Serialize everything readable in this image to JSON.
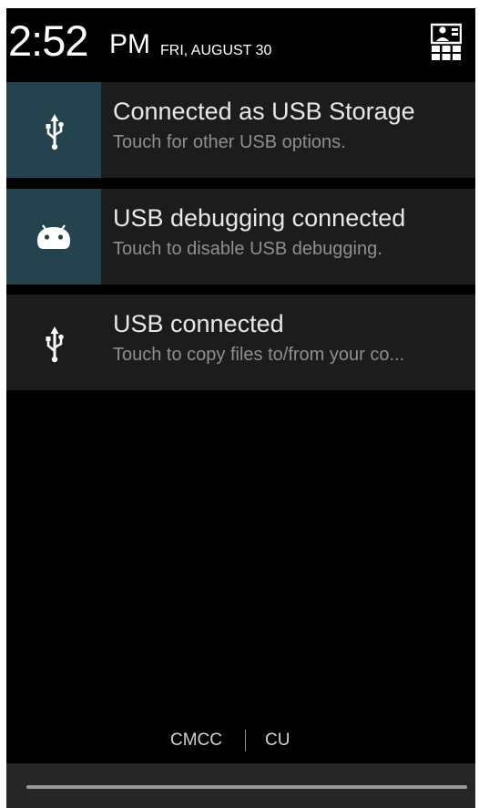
{
  "status_header": {
    "time": "2:52",
    "ampm": "PM",
    "date": "FRI, AUGUST 30",
    "settings_icon": "quick-settings-icon"
  },
  "notifications": [
    {
      "title": "Connected as USB Storage",
      "subtitle": "Touch for other USB options.",
      "icon": "usb-icon",
      "highlighted": true
    },
    {
      "title": "USB debugging connected",
      "subtitle": "Touch to disable USB debugging.",
      "icon": "android-debug-icon",
      "highlighted": true
    },
    {
      "title": "USB connected",
      "subtitle": "Touch to copy files to/from your co...",
      "icon": "usb-icon",
      "highlighted": false
    }
  ],
  "carrier": {
    "primary": "CMCC",
    "secondary": "CU"
  },
  "colors": {
    "background": "#000000",
    "notification_bg": "#1c1c1c",
    "icon_highlight_bg": "#25434f",
    "title_text": "#e8e8e8",
    "subtitle_text": "#8f8f8f",
    "handle": "#9a9a9a"
  }
}
